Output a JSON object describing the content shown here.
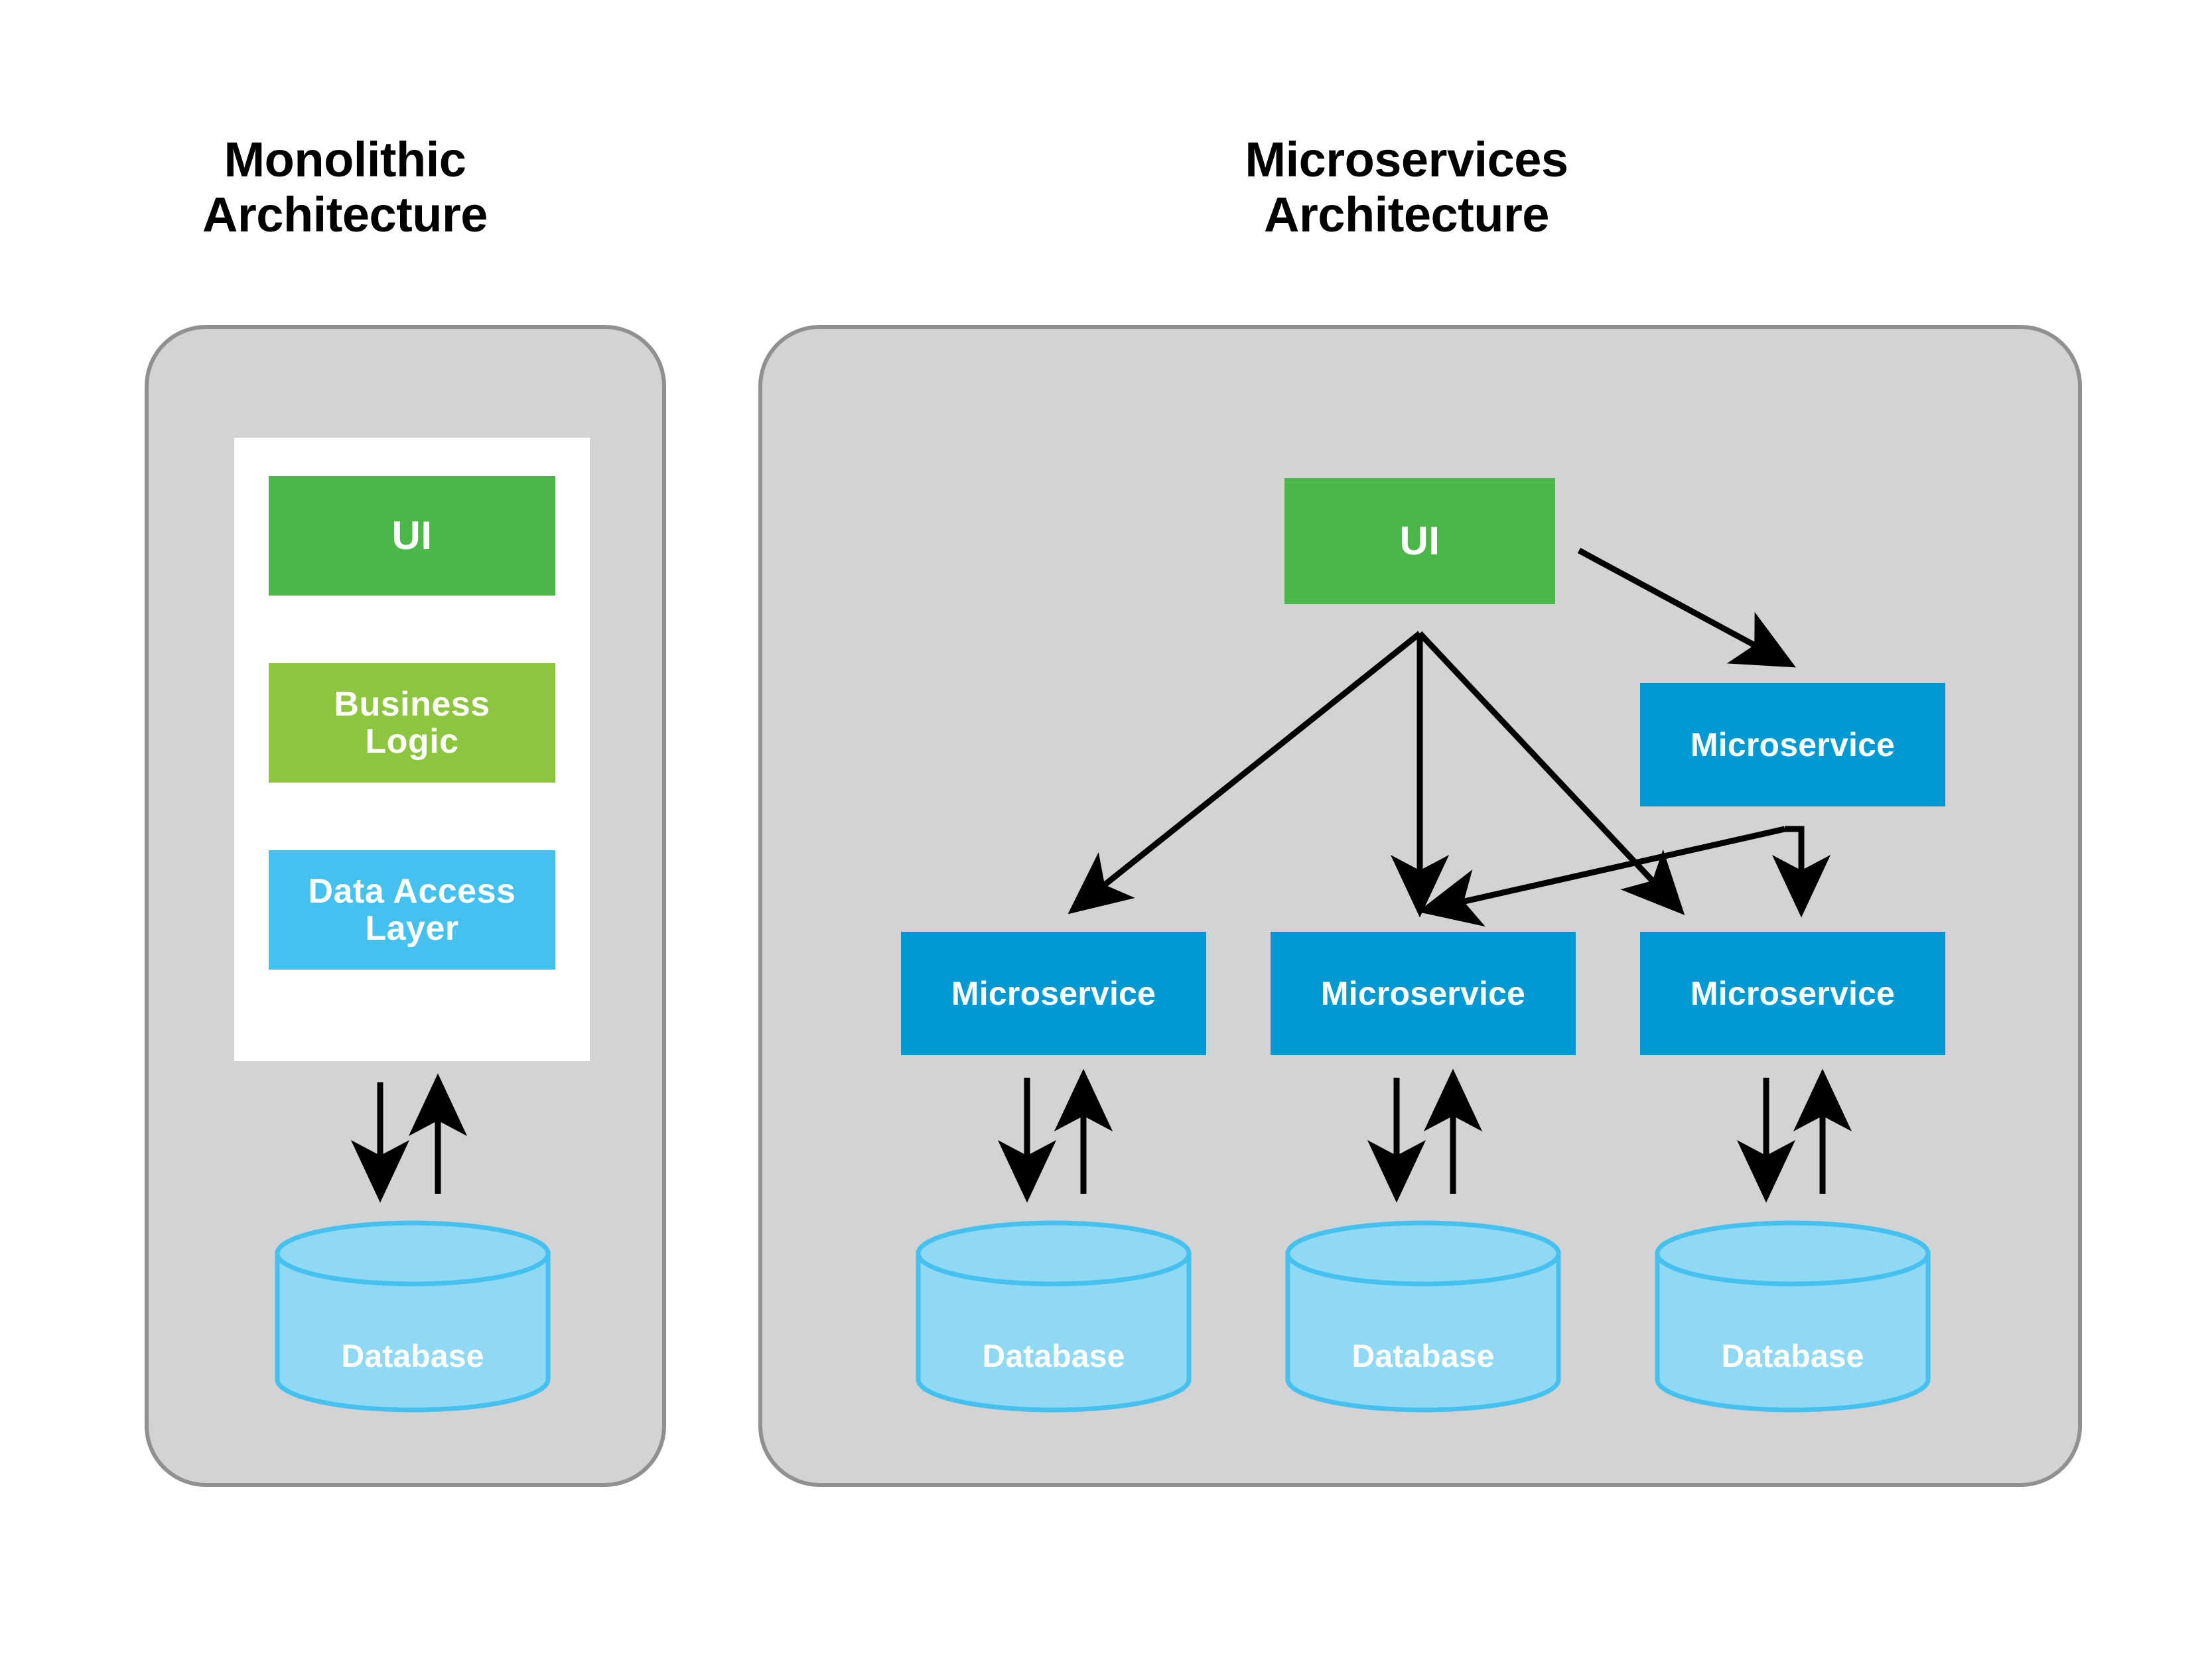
{
  "panels": {
    "monolithic": {
      "title": "Monolithic\nArchitecture",
      "layers": [
        {
          "label": "UI"
        },
        {
          "label": "Business\nLogic"
        },
        {
          "label": "Data Access\nLayer"
        }
      ],
      "database": {
        "label": "Database"
      }
    },
    "microservices": {
      "title": "Microservices\nArchitecture",
      "ui": {
        "label": "UI"
      },
      "services": [
        {
          "label": "Microservice"
        },
        {
          "label": "Microservice"
        },
        {
          "label": "Microservice"
        },
        {
          "label": "Microservice"
        }
      ],
      "databases": [
        {
          "label": "Database"
        },
        {
          "label": "Database"
        },
        {
          "label": "Database"
        }
      ]
    }
  },
  "colors": {
    "page_background": "#ffffff",
    "panel_fill": "#d2d3d4",
    "panel_stroke": "#8e9092",
    "inner_container": "#ffffff",
    "ui_green": "#4cb749",
    "business_logic_green": "#8cc63e",
    "data_access_blue": "#45c1ef",
    "microservice_blue": "#0099d3",
    "database_fill": "#8fd9f5",
    "database_stroke": "#45c1ef",
    "arrow": "#000000",
    "title_text": "#000000",
    "box_text": "#ffffff"
  }
}
